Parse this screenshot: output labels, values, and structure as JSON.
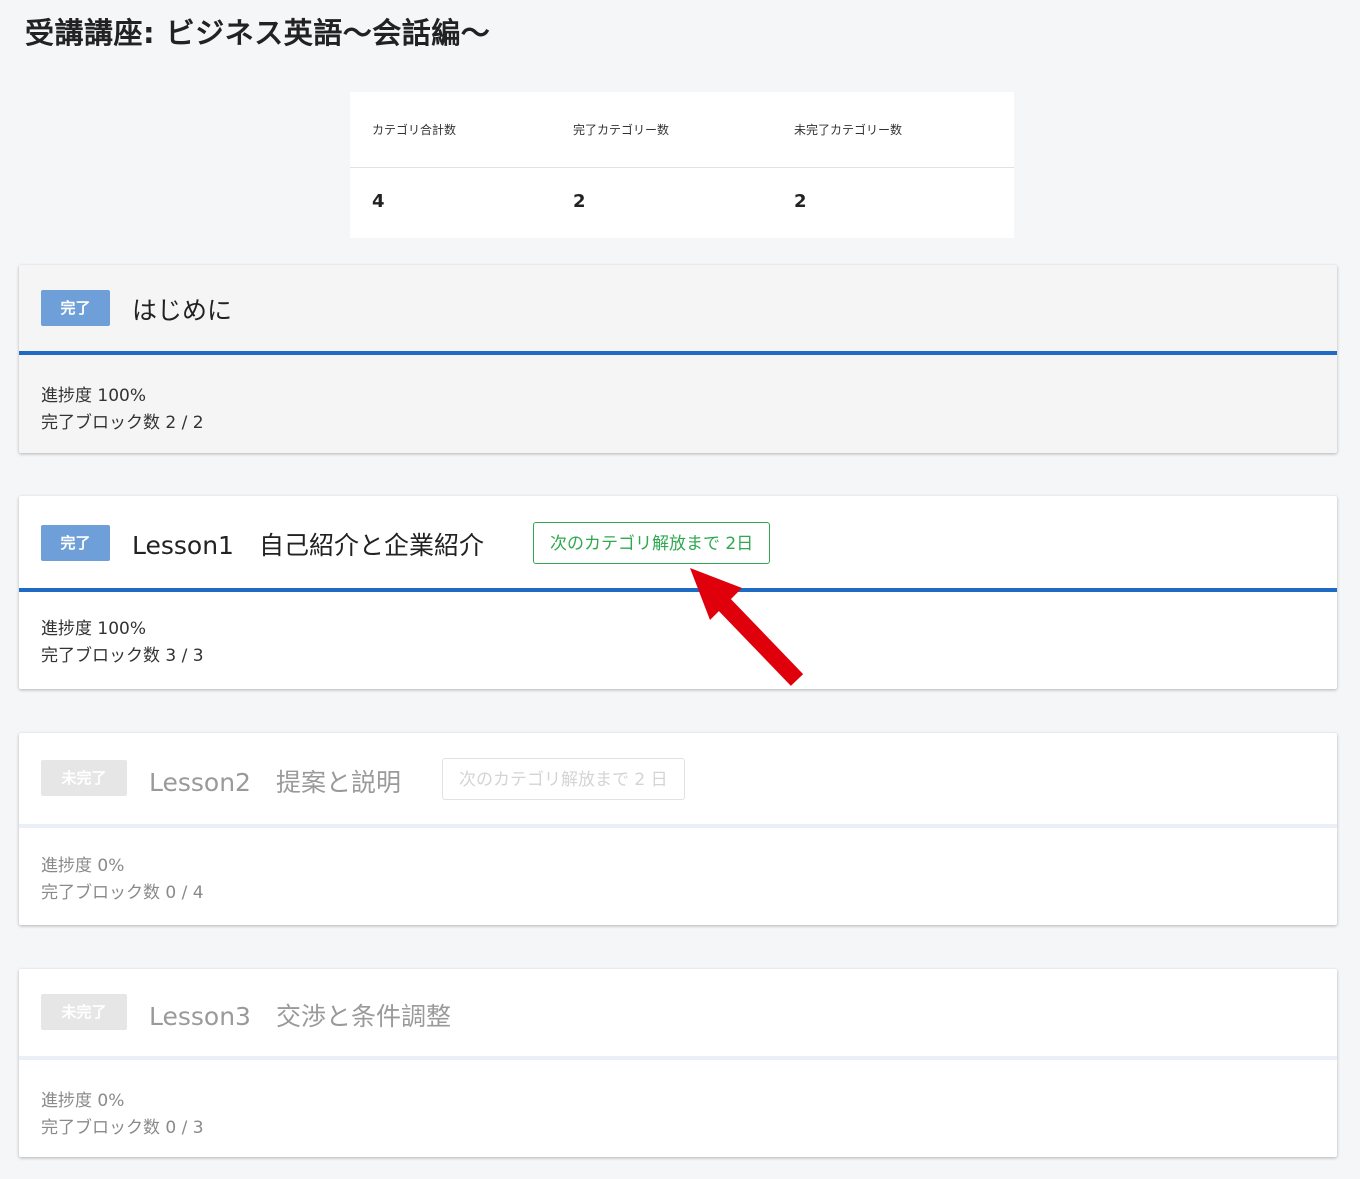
{
  "page": {
    "title": "受講講座: ビジネス英語〜会話編〜"
  },
  "summary": {
    "headers": [
      "カテゴリ合計数",
      "完了カテゴリー数",
      "未完了カテゴリー数"
    ],
    "values": [
      "4",
      "2",
      "2"
    ]
  },
  "categories": [
    {
      "status": "完了",
      "title": "はじめに",
      "progress": "進捗度 100%",
      "blocks": "完了ブロック数 2 / 2"
    },
    {
      "status": "完了",
      "title": "Lesson1　自己紹介と企業紹介",
      "unlock": "次のカテゴリ解放まで 2日",
      "progress": "進捗度 100%",
      "blocks": "完了ブロック数 3 / 3"
    },
    {
      "status": "未完了",
      "title": "Lesson2　提案と説明",
      "unlock": "次のカテゴリ解放まで 2 日",
      "progress": "進捗度 0%",
      "blocks": "完了ブロック数 0 / 4"
    },
    {
      "status": "未完了",
      "title": "Lesson3　交渉と条件調整",
      "progress": "進捗度 0%",
      "blocks": "完了ブロック数 0 / 3"
    }
  ],
  "colors": {
    "accent": "#1f6bc4",
    "badge_done": "#6f9fd8",
    "unlock_green": "#2fa84f",
    "annotation_arrow": "#e0000b"
  }
}
